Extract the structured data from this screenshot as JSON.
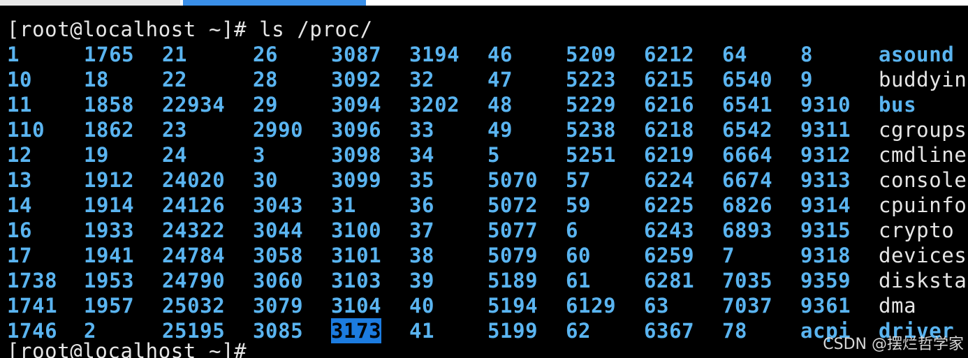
{
  "terminal": {
    "command_prompt": "[root@localhost ~]# ls /proc/",
    "next_prompt": "[root@localhost ~]# ",
    "colors": {
      "background": "#000000",
      "directory": "#5ab4f0",
      "file": "#e6e6e6",
      "selection": "#1c7ce0"
    },
    "selected_entry": "3173",
    "rows": [
      [
        {
          "t": "1",
          "k": "dir"
        },
        {
          "t": "1765",
          "k": "dir"
        },
        {
          "t": "21",
          "k": "dir"
        },
        {
          "t": "26",
          "k": "dir"
        },
        {
          "t": "3087",
          "k": "dir"
        },
        {
          "t": "3194",
          "k": "dir"
        },
        {
          "t": "46",
          "k": "dir"
        },
        {
          "t": "5209",
          "k": "dir"
        },
        {
          "t": "6212",
          "k": "dir"
        },
        {
          "t": "64",
          "k": "dir"
        },
        {
          "t": "8",
          "k": "dir"
        },
        {
          "t": "asound",
          "k": "dir"
        }
      ],
      [
        {
          "t": "10",
          "k": "dir"
        },
        {
          "t": "18",
          "k": "dir"
        },
        {
          "t": "22",
          "k": "dir"
        },
        {
          "t": "28",
          "k": "dir"
        },
        {
          "t": "3092",
          "k": "dir"
        },
        {
          "t": "32",
          "k": "dir"
        },
        {
          "t": "47",
          "k": "dir"
        },
        {
          "t": "5223",
          "k": "dir"
        },
        {
          "t": "6215",
          "k": "dir"
        },
        {
          "t": "6540",
          "k": "dir"
        },
        {
          "t": "9",
          "k": "dir"
        },
        {
          "t": "buddyin",
          "k": "file"
        }
      ],
      [
        {
          "t": "11",
          "k": "dir"
        },
        {
          "t": "1858",
          "k": "dir"
        },
        {
          "t": "22934",
          "k": "dir"
        },
        {
          "t": "29",
          "k": "dir"
        },
        {
          "t": "3094",
          "k": "dir"
        },
        {
          "t": "3202",
          "k": "dir"
        },
        {
          "t": "48",
          "k": "dir"
        },
        {
          "t": "5229",
          "k": "dir"
        },
        {
          "t": "6216",
          "k": "dir"
        },
        {
          "t": "6541",
          "k": "dir"
        },
        {
          "t": "9310",
          "k": "dir"
        },
        {
          "t": "bus",
          "k": "dir"
        }
      ],
      [
        {
          "t": "110",
          "k": "dir"
        },
        {
          "t": "1862",
          "k": "dir"
        },
        {
          "t": "23",
          "k": "dir"
        },
        {
          "t": "2990",
          "k": "dir"
        },
        {
          "t": "3096",
          "k": "dir"
        },
        {
          "t": "33",
          "k": "dir"
        },
        {
          "t": "49",
          "k": "dir"
        },
        {
          "t": "5238",
          "k": "dir"
        },
        {
          "t": "6218",
          "k": "dir"
        },
        {
          "t": "6542",
          "k": "dir"
        },
        {
          "t": "9311",
          "k": "dir"
        },
        {
          "t": "cgroups",
          "k": "file"
        }
      ],
      [
        {
          "t": "12",
          "k": "dir"
        },
        {
          "t": "19",
          "k": "dir"
        },
        {
          "t": "24",
          "k": "dir"
        },
        {
          "t": "3",
          "k": "dir"
        },
        {
          "t": "3098",
          "k": "dir"
        },
        {
          "t": "34",
          "k": "dir"
        },
        {
          "t": "5",
          "k": "dir"
        },
        {
          "t": "5251",
          "k": "dir"
        },
        {
          "t": "6219",
          "k": "dir"
        },
        {
          "t": "6664",
          "k": "dir"
        },
        {
          "t": "9312",
          "k": "dir"
        },
        {
          "t": "cmdline",
          "k": "file"
        }
      ],
      [
        {
          "t": "13",
          "k": "dir"
        },
        {
          "t": "1912",
          "k": "dir"
        },
        {
          "t": "24020",
          "k": "dir"
        },
        {
          "t": "30",
          "k": "dir"
        },
        {
          "t": "3099",
          "k": "dir"
        },
        {
          "t": "35",
          "k": "dir"
        },
        {
          "t": "5070",
          "k": "dir"
        },
        {
          "t": "57",
          "k": "dir"
        },
        {
          "t": "6224",
          "k": "dir"
        },
        {
          "t": "6674",
          "k": "dir"
        },
        {
          "t": "9313",
          "k": "dir"
        },
        {
          "t": "console",
          "k": "file"
        }
      ],
      [
        {
          "t": "14",
          "k": "dir"
        },
        {
          "t": "1914",
          "k": "dir"
        },
        {
          "t": "24126",
          "k": "dir"
        },
        {
          "t": "3043",
          "k": "dir"
        },
        {
          "t": "31",
          "k": "dir"
        },
        {
          "t": "36",
          "k": "dir"
        },
        {
          "t": "5072",
          "k": "dir"
        },
        {
          "t": "59",
          "k": "dir"
        },
        {
          "t": "6225",
          "k": "dir"
        },
        {
          "t": "6826",
          "k": "dir"
        },
        {
          "t": "9314",
          "k": "dir"
        },
        {
          "t": "cpuinfo",
          "k": "file"
        }
      ],
      [
        {
          "t": "16",
          "k": "dir"
        },
        {
          "t": "1933",
          "k": "dir"
        },
        {
          "t": "24322",
          "k": "dir"
        },
        {
          "t": "3044",
          "k": "dir"
        },
        {
          "t": "3100",
          "k": "dir"
        },
        {
          "t": "37",
          "k": "dir"
        },
        {
          "t": "5077",
          "k": "dir"
        },
        {
          "t": "6",
          "k": "dir"
        },
        {
          "t": "6243",
          "k": "dir"
        },
        {
          "t": "6893",
          "k": "dir"
        },
        {
          "t": "9315",
          "k": "dir"
        },
        {
          "t": "crypto",
          "k": "file"
        }
      ],
      [
        {
          "t": "17",
          "k": "dir"
        },
        {
          "t": "1941",
          "k": "dir"
        },
        {
          "t": "24784",
          "k": "dir"
        },
        {
          "t": "3058",
          "k": "dir"
        },
        {
          "t": "3101",
          "k": "dir"
        },
        {
          "t": "38",
          "k": "dir"
        },
        {
          "t": "5079",
          "k": "dir"
        },
        {
          "t": "60",
          "k": "dir"
        },
        {
          "t": "6259",
          "k": "dir"
        },
        {
          "t": "7",
          "k": "dir"
        },
        {
          "t": "9318",
          "k": "dir"
        },
        {
          "t": "devices",
          "k": "file"
        }
      ],
      [
        {
          "t": "1738",
          "k": "dir"
        },
        {
          "t": "1953",
          "k": "dir"
        },
        {
          "t": "24790",
          "k": "dir"
        },
        {
          "t": "3060",
          "k": "dir"
        },
        {
          "t": "3103",
          "k": "dir"
        },
        {
          "t": "39",
          "k": "dir"
        },
        {
          "t": "5189",
          "k": "dir"
        },
        {
          "t": "61",
          "k": "dir"
        },
        {
          "t": "6281",
          "k": "dir"
        },
        {
          "t": "7035",
          "k": "dir"
        },
        {
          "t": "9359",
          "k": "dir"
        },
        {
          "t": "disksta",
          "k": "file"
        }
      ],
      [
        {
          "t": "1741",
          "k": "dir"
        },
        {
          "t": "1957",
          "k": "dir"
        },
        {
          "t": "25032",
          "k": "dir"
        },
        {
          "t": "3079",
          "k": "dir"
        },
        {
          "t": "3104",
          "k": "dir"
        },
        {
          "t": "40",
          "k": "dir"
        },
        {
          "t": "5194",
          "k": "dir"
        },
        {
          "t": "6129",
          "k": "dir"
        },
        {
          "t": "63",
          "k": "dir"
        },
        {
          "t": "7037",
          "k": "dir"
        },
        {
          "t": "9361",
          "k": "dir"
        },
        {
          "t": "dma",
          "k": "file"
        }
      ],
      [
        {
          "t": "1746",
          "k": "dir"
        },
        {
          "t": "2",
          "k": "dir"
        },
        {
          "t": "25195",
          "k": "dir"
        },
        {
          "t": "3085",
          "k": "dir"
        },
        {
          "t": "3173",
          "k": "dir"
        },
        {
          "t": "41",
          "k": "dir"
        },
        {
          "t": "5199",
          "k": "dir"
        },
        {
          "t": "62",
          "k": "dir"
        },
        {
          "t": "6367",
          "k": "dir"
        },
        {
          "t": "78",
          "k": "dir"
        },
        {
          "t": "acpi",
          "k": "dir"
        },
        {
          "t": "driver",
          "k": "dir"
        }
      ]
    ]
  },
  "watermark": "CSDN @摆烂哲学家"
}
